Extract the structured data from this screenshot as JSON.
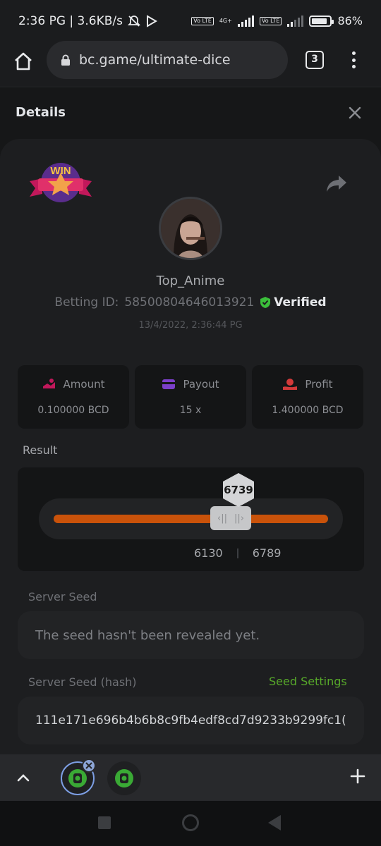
{
  "status_bar": {
    "left_text": "2:36 PG | 3.6KB/s",
    "volte1": "Vo LTE",
    "volte2": "Vo LTE",
    "net_type": "4G+",
    "battery_text": "86%",
    "battery_level": 0.86
  },
  "browser": {
    "url": "bc.game/ultimate-dice",
    "tab_count": "3"
  },
  "details": {
    "title": "Details"
  },
  "bet": {
    "badge_text": "WIN",
    "username": "Top_Anime",
    "betting_id_label": "Betting ID:",
    "betting_id": "58500804646013921",
    "verified_label": "Verified",
    "timestamp": "13/4/2022, 2:36:44 PG"
  },
  "stats": {
    "amount_label": "Amount",
    "amount_value": "0.100000 BCD",
    "payout_label": "Payout",
    "payout_value": "15 x",
    "profit_label": "Profit",
    "profit_value": "1.400000 BCD"
  },
  "result": {
    "label": "Result",
    "value": "6739",
    "range_low": "6130",
    "range_high": "6789"
  },
  "server_seed": {
    "label": "Server Seed",
    "value": "The seed hasn't been revealed yet.",
    "hash_label": "Server Seed (hash)",
    "settings_link": "Seed Settings",
    "hash_value": "111e171e696b4b6b8c9fb4edf8cd7d9233b9299fc1("
  },
  "colors": {
    "accent_orange": "#c9520a",
    "verified_green": "#3bbf3b",
    "link_green": "#57a82a"
  }
}
